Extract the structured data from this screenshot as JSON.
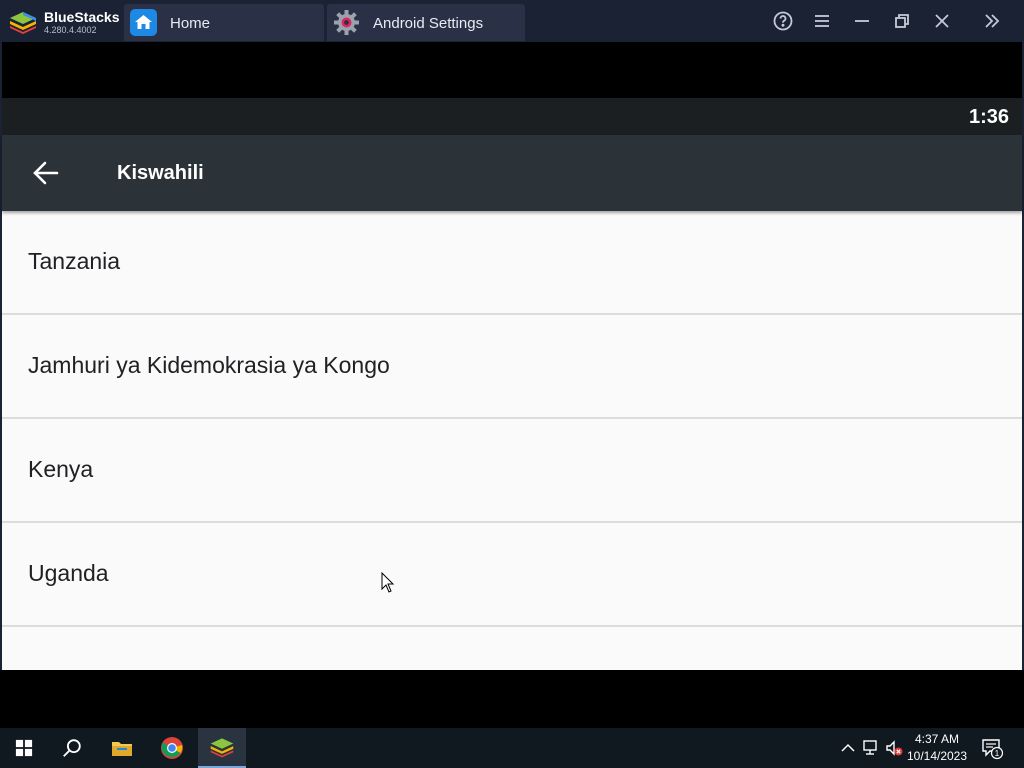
{
  "window": {
    "brand_name": "BlueStacks",
    "brand_version": "4.280.4.4002",
    "tabs": [
      {
        "label": "Home",
        "icon": "home-icon"
      },
      {
        "label": "Android Settings",
        "icon": "gear-icon"
      }
    ],
    "controls": [
      "help-icon",
      "menu-icon",
      "minimize-icon",
      "restore-icon",
      "close-icon",
      "expand-sidebar-icon"
    ]
  },
  "android": {
    "status_clock": "1:36",
    "appbar_title": "Kiswahili",
    "regions": [
      {
        "label": "Tanzania"
      },
      {
        "label": "Jamhuri ya Kidemokrasia ya Kongo"
      },
      {
        "label": "Kenya"
      },
      {
        "label": "Uganda"
      }
    ]
  },
  "taskbar": {
    "pinned": [
      "windows-start-icon",
      "search-icon",
      "file-explorer-icon",
      "chrome-icon",
      "bluestacks-icon"
    ],
    "time": "4:37 AM",
    "date": "10/14/2023",
    "notification_count": "1"
  },
  "colors": {
    "titlebar": "#1b2234",
    "tab": "#2a3147",
    "android_appbar": "#2c3338",
    "android_statusbar": "#1b1f22",
    "list_background": "#fafafa",
    "taskbar": "#101820"
  }
}
